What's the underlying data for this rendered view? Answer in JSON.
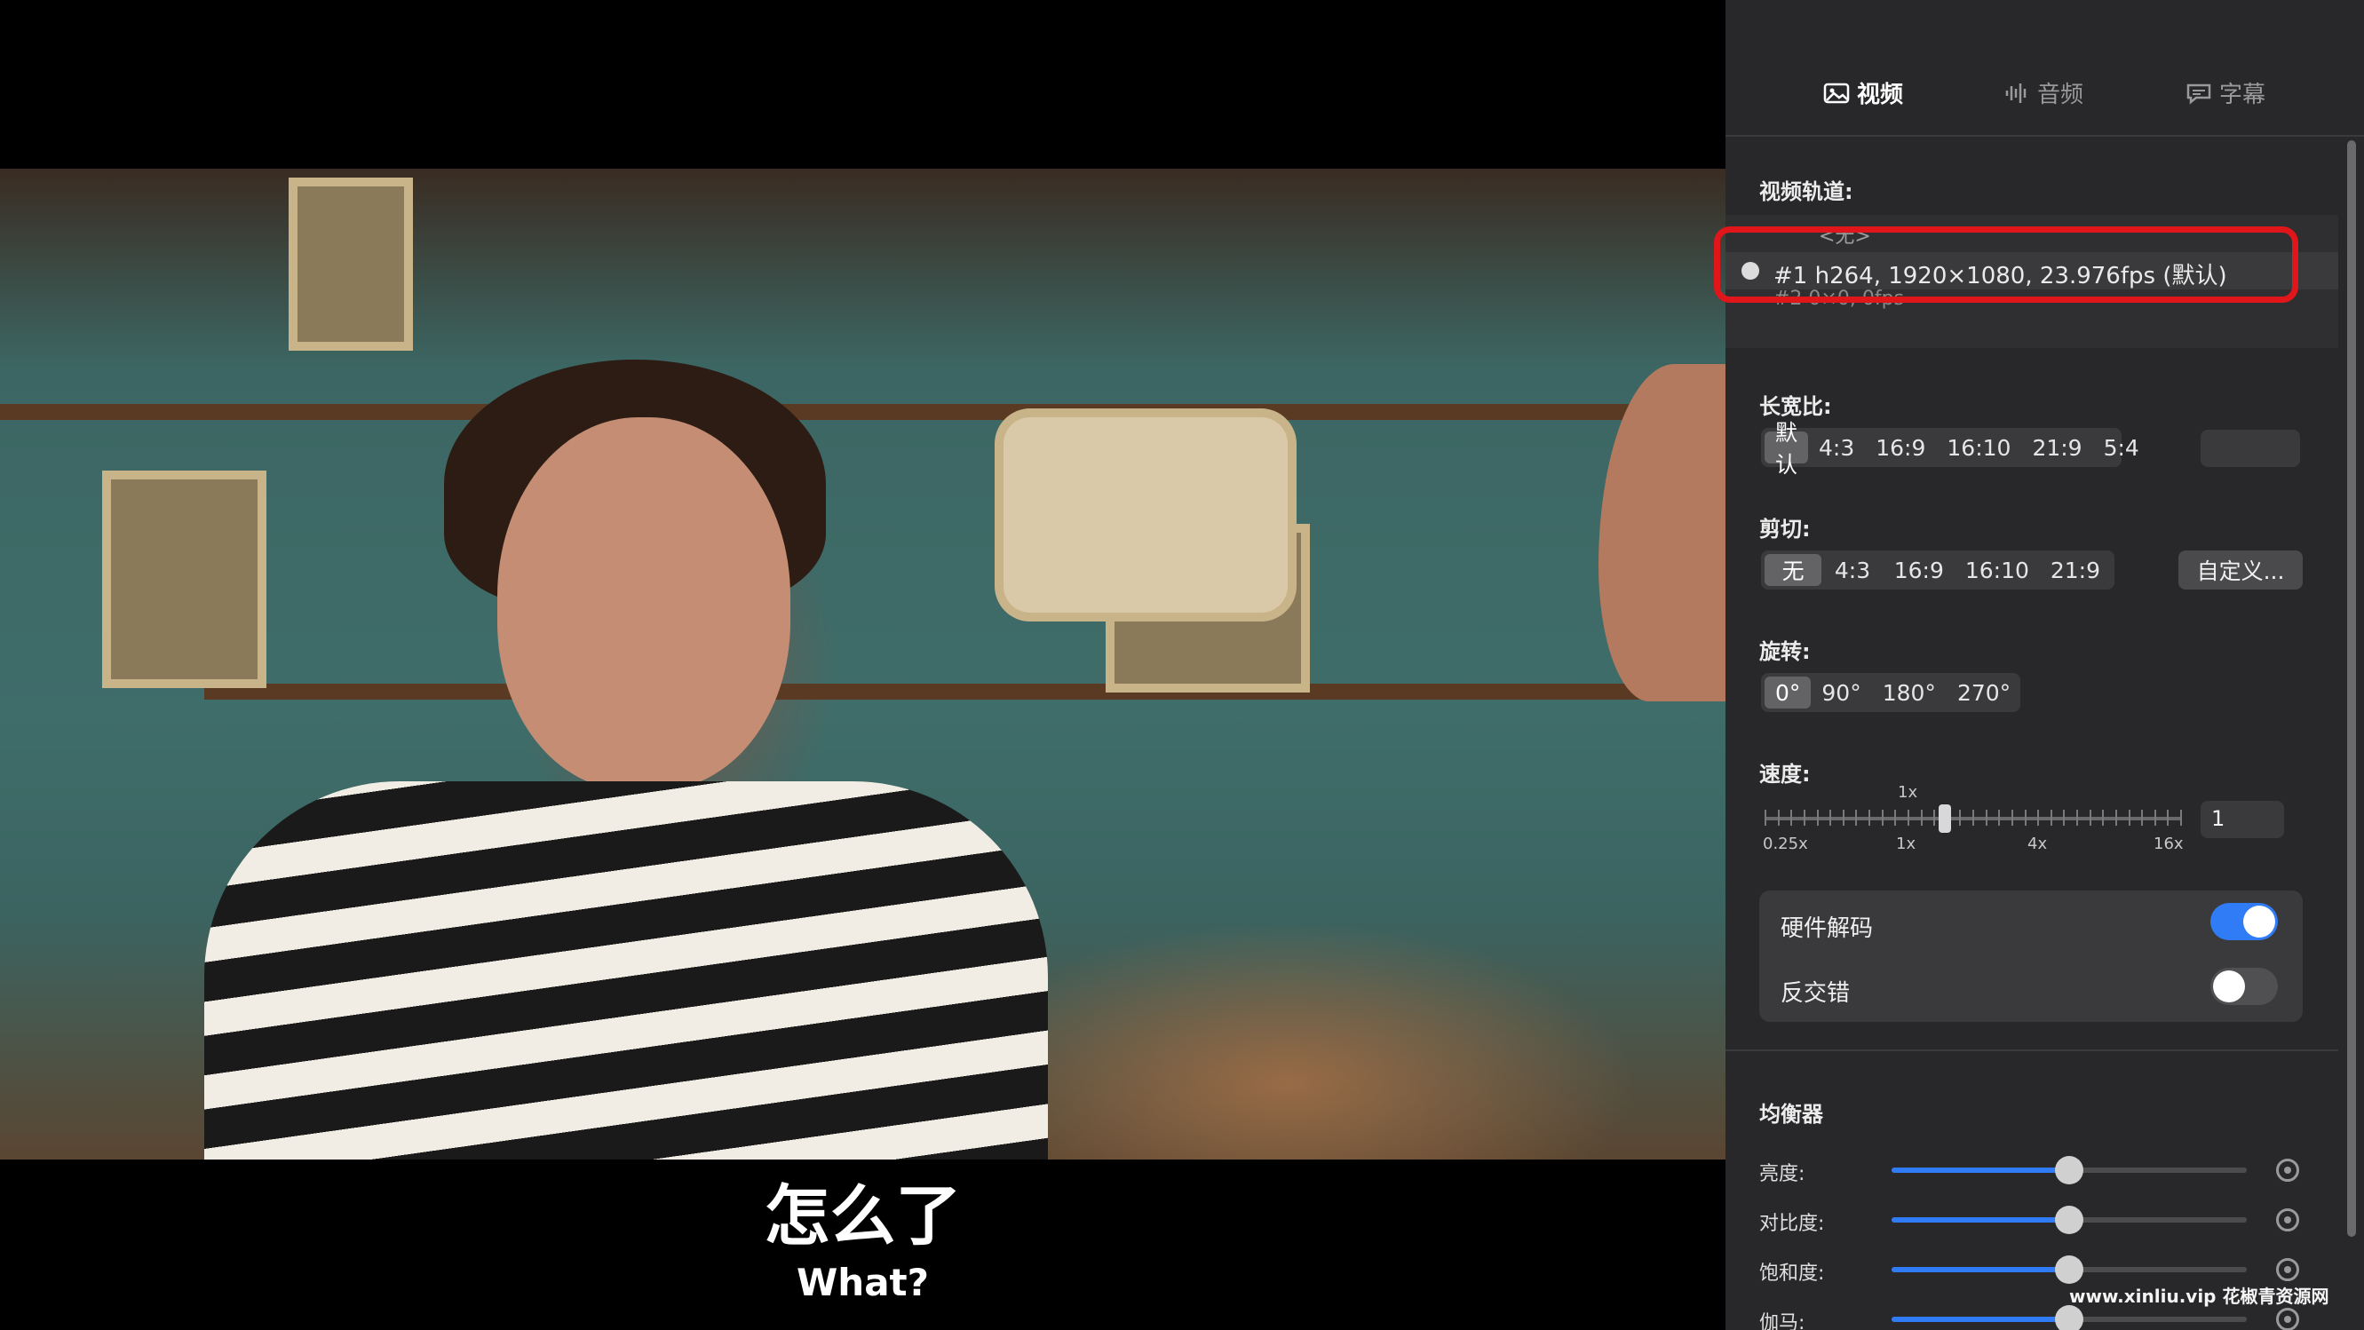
{
  "subtitles": {
    "primary": "怎么了",
    "secondary": "What?"
  },
  "tabs": [
    {
      "label": "视频",
      "icon": "image-icon",
      "active": true
    },
    {
      "label": "音频",
      "icon": "waveform-icon",
      "active": false
    },
    {
      "label": "字幕",
      "icon": "speech-bubble-icon",
      "active": false
    }
  ],
  "video_track": {
    "label": "视频轨道:",
    "items": [
      {
        "text": "<无>"
      },
      {
        "text": "#1  h264, 1920×1080, 23.976fps (默认)",
        "selected": true
      },
      {
        "text": "#2  0×0, 0fps"
      }
    ]
  },
  "aspect_ratio": {
    "label": "长宽比:",
    "options": [
      "默认",
      "4:3",
      "16:9",
      "16:10",
      "21:9",
      "5:4"
    ],
    "selected": "默认",
    "custom_value": ""
  },
  "crop": {
    "label": "剪切:",
    "options": [
      "无",
      "4:3",
      "16:9",
      "16:10",
      "21:9"
    ],
    "selected": "无",
    "custom_button": "自定义..."
  },
  "rotation": {
    "label": "旋转:",
    "options": [
      "0°",
      "90°",
      "180°",
      "270°"
    ],
    "selected": "0°"
  },
  "speed": {
    "label": "速度:",
    "current_marker": "1x",
    "ticks": [
      "0.25x",
      "1x",
      "4x",
      "16x"
    ],
    "value": "1"
  },
  "toggles": [
    {
      "label": "硬件解码",
      "on": true
    },
    {
      "label": "反交错",
      "on": false
    }
  ],
  "equalizer": {
    "label": "均衡器",
    "sliders": [
      {
        "label": "亮度:",
        "level": 0.5
      },
      {
        "label": "对比度:",
        "level": 0.5
      },
      {
        "label": "饱和度:",
        "level": 0.5
      },
      {
        "label": "伽马:",
        "level": 0.5
      }
    ]
  },
  "watermark": "www.xinliu.vip  花椒青资源网",
  "colors": {
    "accent": "#2f7cf6",
    "highlight": "#e0161b",
    "panel_bg": "#28282a"
  }
}
